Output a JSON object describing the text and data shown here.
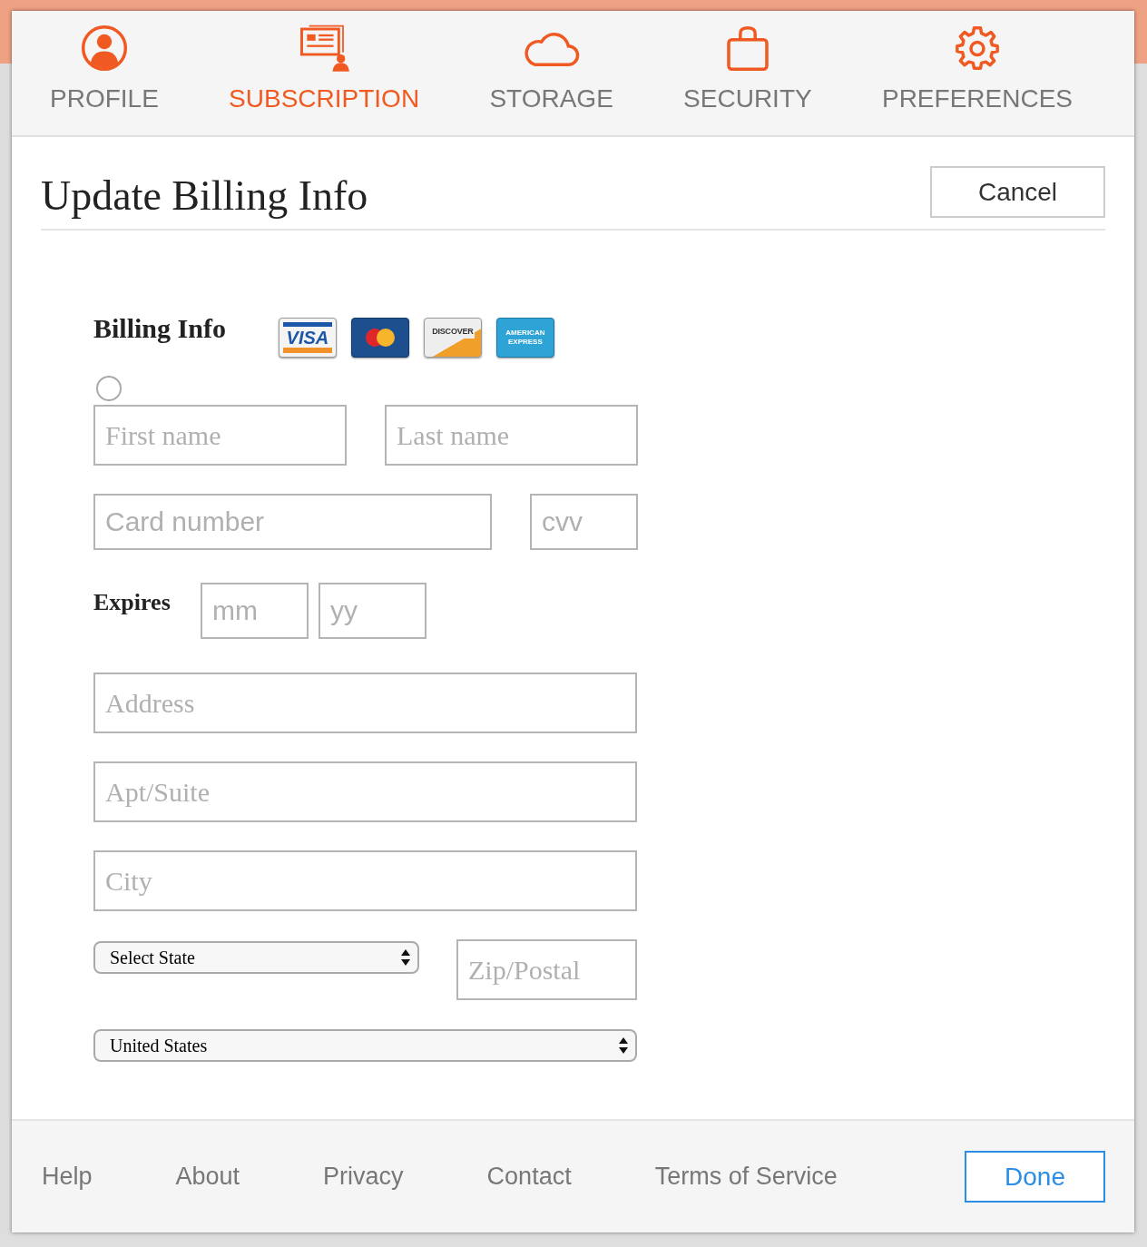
{
  "tabs": [
    {
      "label": "PROFILE",
      "selected": false
    },
    {
      "label": "SUBSCRIPTION",
      "selected": true
    },
    {
      "label": "STORAGE",
      "selected": false
    },
    {
      "label": "SECURITY",
      "selected": false
    },
    {
      "label": "PREFERENCES",
      "selected": false
    }
  ],
  "title": "Update Billing Info",
  "cancel": "Cancel",
  "billing": {
    "label": "Billing Info",
    "cards": [
      {
        "kind": "visa",
        "text": "VISA"
      },
      {
        "kind": "mastercard"
      },
      {
        "kind": "discover",
        "text": "DISCOVER"
      },
      {
        "kind": "amex",
        "text": "AMERICAN EXPRESS"
      }
    ]
  },
  "radio": {
    "selected": false
  },
  "first_name": {
    "placeholder": "First name"
  },
  "last_name": {
    "placeholder": "Last name"
  },
  "card_number": {
    "placeholder": "Card number"
  },
  "cvv": {
    "placeholder": "cvv"
  },
  "expires": {
    "label": "Expires",
    "month": {
      "placeholder": "mm"
    },
    "year": {
      "placeholder": "yy"
    }
  },
  "address": {
    "placeholder": "Address"
  },
  "apt": {
    "placeholder": "Apt/Suite"
  },
  "city": {
    "placeholder": "City"
  },
  "state": {
    "value": "Select State"
  },
  "zip": {
    "placeholder": "Zip/Postal"
  },
  "country": {
    "value": "United States"
  },
  "footer": {
    "links": [
      "Help",
      "About",
      "Privacy",
      "Contact",
      "Terms of Service"
    ],
    "done": "Done"
  }
}
